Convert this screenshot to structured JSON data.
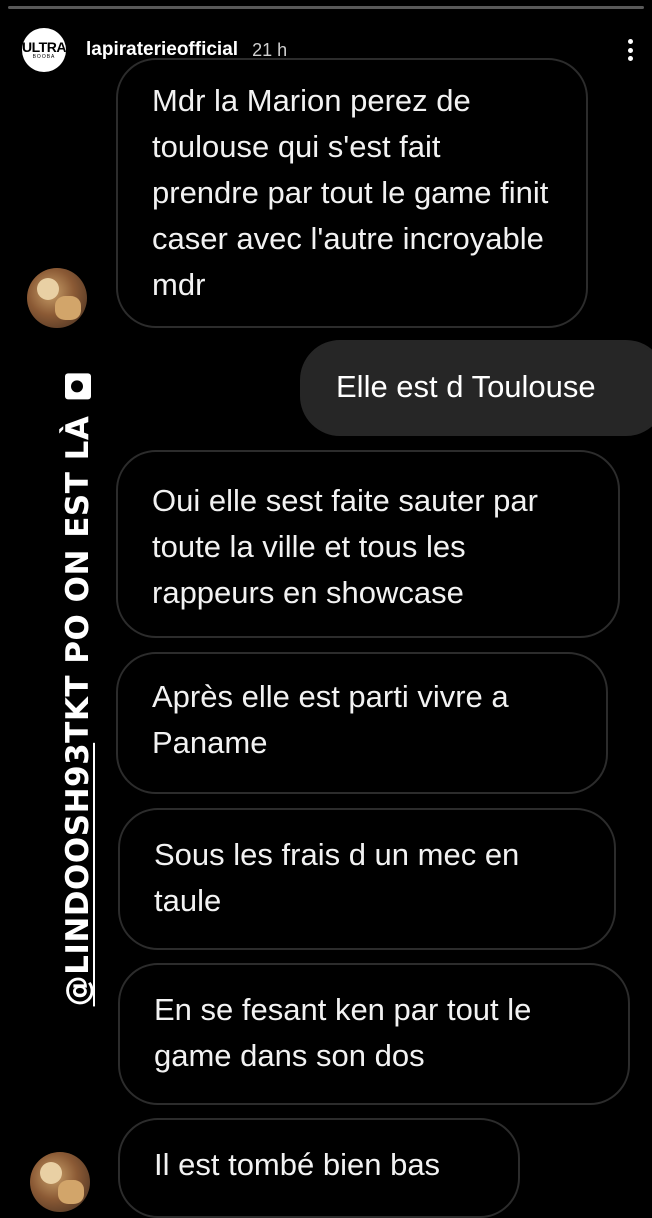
{
  "story": {
    "account": "lapiraterieofficial",
    "time": "21 h",
    "logo_text": "ULTRA",
    "logo_sub": "BOOBA"
  },
  "sticker": {
    "handle": "@LINDOOSH93",
    "text": " TKT PO ON EST LÀ",
    "emoji": "pirate-flag-icon"
  },
  "messages": [
    {
      "side": "received",
      "text": "Mdr la Marion perez de toulouse qui s'est fait prendre par tout le game finit caser avec l'autre incroyable mdr"
    },
    {
      "side": "sent",
      "text": "Elle est d Toulouse"
    },
    {
      "side": "received",
      "text": "Oui elle sest faite sauter par toute la ville et tous les rappeurs en showcase"
    },
    {
      "side": "received",
      "text": "Après elle est parti vivre a Paname"
    },
    {
      "side": "received",
      "text": "Sous les frais d un mec en taule"
    },
    {
      "side": "received",
      "text": "En se fesant ken par tout le game dans son dos"
    },
    {
      "side": "received",
      "text": "Il est tombé bien bas"
    }
  ]
}
